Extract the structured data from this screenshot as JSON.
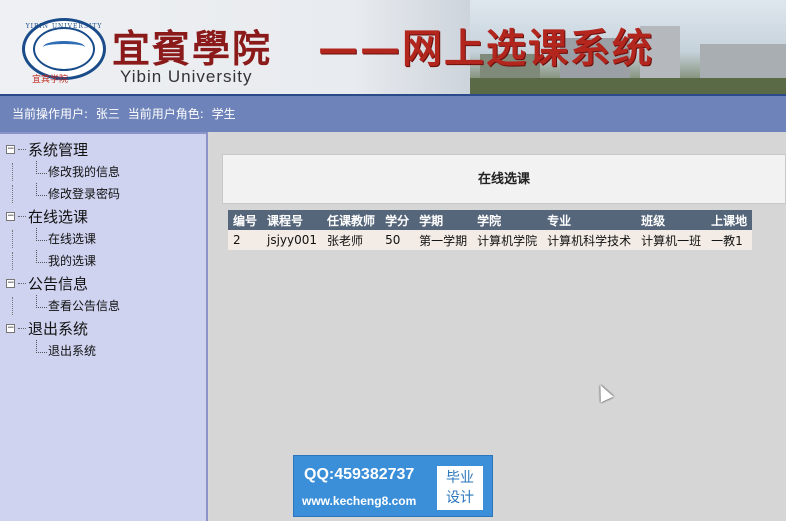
{
  "banner": {
    "logo_arc": "YIBIN UNIVERSITY",
    "logo_red": "宜宾学院",
    "school_cn": "宜賓學院",
    "school_en": "Yibin University",
    "system_title": "——网上选课系统"
  },
  "status": {
    "user_label": "当前操作用户:",
    "user_name": "张三",
    "role_label": "当前用户角色:",
    "role_name": "学生"
  },
  "sidebar": {
    "groups": [
      {
        "label": "系统管理",
        "items": [
          "修改我的信息",
          "修改登录密码"
        ]
      },
      {
        "label": "在线选课",
        "items": [
          "在线选课",
          "我的选课"
        ]
      },
      {
        "label": "公告信息",
        "items": [
          "查看公告信息"
        ]
      },
      {
        "label": "退出系统",
        "items": [
          "退出系统"
        ]
      }
    ]
  },
  "main": {
    "page_title": "在线选课",
    "table": {
      "headers": [
        "编号",
        "课程号",
        "任课教师",
        "学分",
        "学期",
        "学院",
        "专业",
        "班级",
        "上课地"
      ],
      "rows": [
        [
          "2",
          "jsjyy001",
          "张老师",
          "50",
          "第一学期",
          "计算机学院",
          "计算机科学技术",
          "计算机一班",
          "一教1"
        ]
      ]
    }
  },
  "watermark": {
    "qq": "QQ:459382737",
    "site": "www.kecheng8.com",
    "badge_line1": "毕业",
    "badge_line2": "设计"
  }
}
